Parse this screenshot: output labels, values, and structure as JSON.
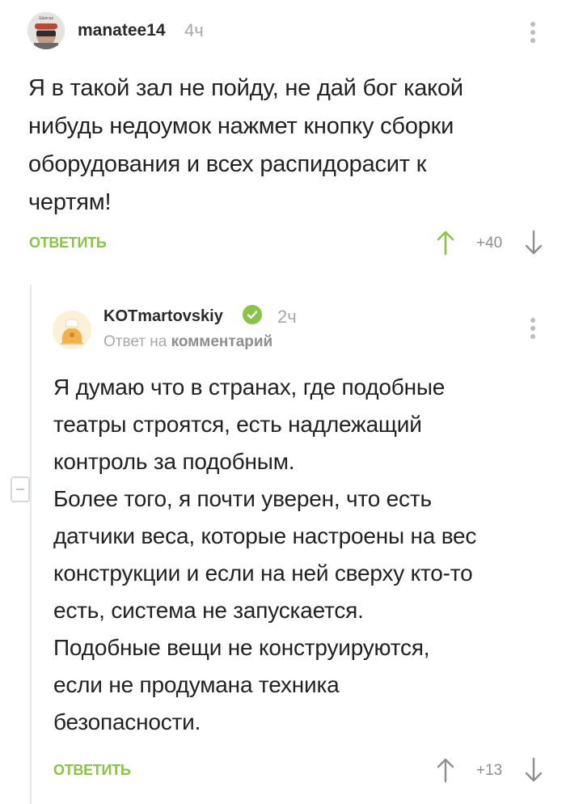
{
  "comments": [
    {
      "username": "manatee14",
      "time": "4ч",
      "text_lines": [
        "Я в такой зал не пойду, не дай бог какой",
        "нибудь недоумок нажмет кнопку сборки",
        "оборудования и всех распидорасит к",
        "чертям!"
      ],
      "reply_label": "ОТВЕТИТЬ",
      "rating": "+40",
      "avatar_caption": "Шапсак"
    },
    {
      "username": "KOTmartovskiy",
      "time": "2ч",
      "reply_to_prefix": "Ответ на",
      "reply_to_link": "комментарий",
      "text_lines": [
        "Я думаю что в странах, где подобные",
        "театры строятся, есть надлежащий",
        "контроль за подобным.",
        "Более того, я почти уверен, что есть",
        "датчики веса, которые настроены на вес",
        "конструкции и если на ней сверху кто-то",
        "есть, система не запускается.",
        "Подобные вещи не конструируются,",
        "если не продумана техника",
        "безопасности."
      ],
      "reply_label": "ОТВЕТИТЬ",
      "rating": "+13"
    }
  ],
  "colors": {
    "accent": "#8bc34a",
    "muted": "#a8a8a8",
    "text": "#222222"
  },
  "icons": [
    "kebab-menu-icon",
    "arrow-up-icon",
    "arrow-down-icon",
    "verified-check-icon",
    "collapse-minus-icon"
  ]
}
